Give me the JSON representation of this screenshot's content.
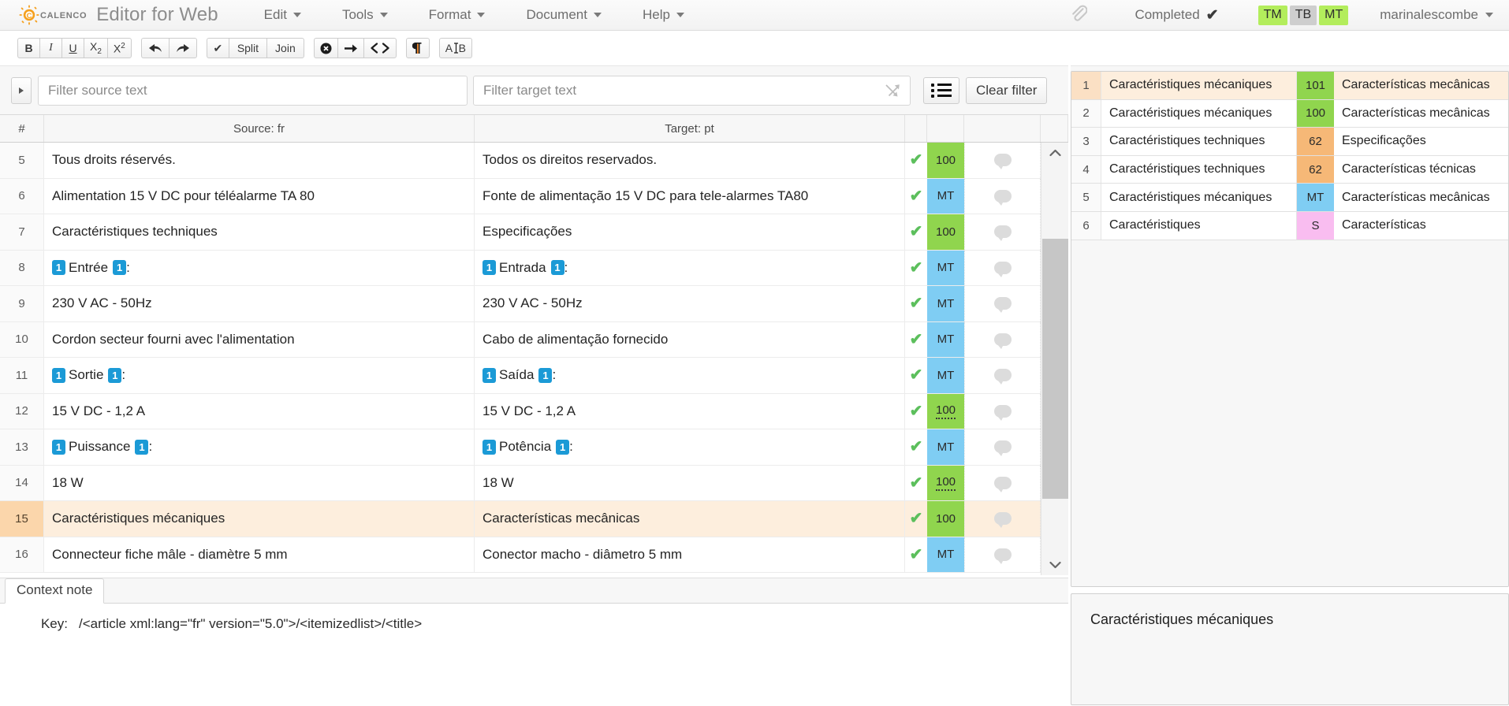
{
  "app": {
    "brand_word": "CALENCO",
    "title": "Editor for Web",
    "accent_orange": "#f5a01e"
  },
  "menubar": {
    "items": [
      {
        "label": "Edit"
      },
      {
        "label": "Tools"
      },
      {
        "label": "Format"
      },
      {
        "label": "Document"
      },
      {
        "label": "Help"
      }
    ],
    "attach_icon": "paperclip-icon",
    "status": {
      "label": "Completed",
      "icon": "check-icon"
    },
    "badges": [
      {
        "label": "TM",
        "color": "#b3ed5c",
        "state": "green"
      },
      {
        "label": "TB",
        "color": "#cecece",
        "state": "grey"
      },
      {
        "label": "MT",
        "color": "#b3ed5c",
        "state": "green"
      }
    ],
    "user": "marinalescombe"
  },
  "toolbar": {
    "groups": [
      [
        {
          "name": "bold",
          "label": "B"
        },
        {
          "name": "italic",
          "label": "I"
        },
        {
          "name": "underline",
          "label": "U"
        },
        {
          "name": "subscript",
          "label": "X2"
        },
        {
          "name": "superscript",
          "label": "X2"
        }
      ],
      [
        {
          "name": "undo",
          "label": "←"
        },
        {
          "name": "redo",
          "label": "→"
        }
      ],
      [
        {
          "name": "validate",
          "label": "✔"
        },
        {
          "name": "split",
          "label": "Split"
        },
        {
          "name": "join",
          "label": "Join"
        }
      ],
      [
        {
          "name": "clear-formatting",
          "label": "✖"
        },
        {
          "name": "insert-tag",
          "label": "➔"
        },
        {
          "name": "show-code",
          "label": "<>"
        }
      ],
      [
        {
          "name": "pilcrow",
          "label": "¶"
        }
      ],
      [
        {
          "name": "compare",
          "label": "A|B"
        }
      ]
    ]
  },
  "filterbar": {
    "expand_button": "▸",
    "source_placeholder": "Filter source text",
    "source_value": "",
    "target_placeholder": "Filter target text",
    "target_value": "",
    "swap_icon": "swap-arrows-icon",
    "list_button": "list-icon",
    "clear_filter_label": "Clear filter"
  },
  "grid": {
    "columns": {
      "num": "#",
      "source": "Source: fr",
      "target": "Target: pt"
    },
    "rows": [
      {
        "num": "5",
        "source_parts": [
          {
            "t": "text",
            "v": "Tous droits réservés."
          }
        ],
        "target_parts": [
          {
            "t": "text",
            "v": "Todos os direitos reservados."
          }
        ],
        "validated": true,
        "score": "100",
        "score_color": "g",
        "score_underline": false,
        "highlight": false
      },
      {
        "num": "6",
        "source_parts": [
          {
            "t": "text",
            "v": "Alimentation 15 V DC pour téléalarme TA 80"
          }
        ],
        "target_parts": [
          {
            "t": "text",
            "v": "Fonte de alimentação 15 V DC para tele-alarmes TA80"
          }
        ],
        "validated": true,
        "score": "MT",
        "score_color": "b",
        "score_underline": false,
        "highlight": false
      },
      {
        "num": "7",
        "source_parts": [
          {
            "t": "text",
            "v": "Caractéristiques techniques"
          }
        ],
        "target_parts": [
          {
            "t": "text",
            "v": "Especificações"
          }
        ],
        "validated": true,
        "score": "100",
        "score_color": "g",
        "score_underline": false,
        "highlight": false
      },
      {
        "num": "8",
        "source_parts": [
          {
            "t": "tag",
            "v": "1"
          },
          {
            "t": "text",
            "v": "Entrée "
          },
          {
            "t": "tag",
            "v": "1"
          },
          {
            "t": "text",
            "v": ":"
          }
        ],
        "target_parts": [
          {
            "t": "tag",
            "v": "1"
          },
          {
            "t": "text",
            "v": "Entrada "
          },
          {
            "t": "tag",
            "v": "1"
          },
          {
            "t": "text",
            "v": ":"
          }
        ],
        "validated": true,
        "score": "MT",
        "score_color": "b",
        "score_underline": false,
        "highlight": false
      },
      {
        "num": "9",
        "source_parts": [
          {
            "t": "text",
            "v": "230 V AC - 50Hz"
          }
        ],
        "target_parts": [
          {
            "t": "text",
            "v": "230 V AC - 50Hz"
          }
        ],
        "validated": true,
        "score": "MT",
        "score_color": "b",
        "score_underline": false,
        "highlight": false
      },
      {
        "num": "10",
        "source_parts": [
          {
            "t": "text",
            "v": "Cordon secteur fourni avec l'alimentation"
          }
        ],
        "target_parts": [
          {
            "t": "text",
            "v": "Cabo de alimentação fornecido"
          }
        ],
        "validated": true,
        "score": "MT",
        "score_color": "b",
        "score_underline": false,
        "highlight": false
      },
      {
        "num": "11",
        "source_parts": [
          {
            "t": "tag",
            "v": "1"
          },
          {
            "t": "text",
            "v": "Sortie "
          },
          {
            "t": "tag",
            "v": "1"
          },
          {
            "t": "text",
            "v": ":"
          }
        ],
        "target_parts": [
          {
            "t": "tag",
            "v": "1"
          },
          {
            "t": "text",
            "v": "Saída "
          },
          {
            "t": "tag",
            "v": "1"
          },
          {
            "t": "text",
            "v": ":"
          }
        ],
        "validated": true,
        "score": "MT",
        "score_color": "b",
        "score_underline": false,
        "highlight": false
      },
      {
        "num": "12",
        "source_parts": [
          {
            "t": "text",
            "v": "15 V DC - 1,2 A"
          }
        ],
        "target_parts": [
          {
            "t": "text",
            "v": "15 V DC - 1,2 A"
          }
        ],
        "validated": true,
        "score": "100",
        "score_color": "g",
        "score_underline": true,
        "highlight": false
      },
      {
        "num": "13",
        "source_parts": [
          {
            "t": "tag",
            "v": "1"
          },
          {
            "t": "text",
            "v": "Puissance "
          },
          {
            "t": "tag",
            "v": "1"
          },
          {
            "t": "text",
            "v": " :"
          }
        ],
        "target_parts": [
          {
            "t": "tag",
            "v": "1"
          },
          {
            "t": "text",
            "v": "Potência "
          },
          {
            "t": "tag",
            "v": "1"
          },
          {
            "t": "text",
            "v": ":"
          }
        ],
        "validated": true,
        "score": "MT",
        "score_color": "b",
        "score_underline": false,
        "highlight": false
      },
      {
        "num": "14",
        "source_parts": [
          {
            "t": "text",
            "v": "18 W"
          }
        ],
        "target_parts": [
          {
            "t": "text",
            "v": "18 W"
          }
        ],
        "validated": true,
        "score": "100",
        "score_color": "g",
        "score_underline": true,
        "highlight": false
      },
      {
        "num": "15",
        "source_parts": [
          {
            "t": "text",
            "v": "Caractéristiques mécaniques"
          }
        ],
        "target_parts": [
          {
            "t": "text",
            "v": "Características mecânicas"
          }
        ],
        "validated": true,
        "score": "100",
        "score_color": "g",
        "score_underline": false,
        "highlight": true
      },
      {
        "num": "16",
        "source_parts": [
          {
            "t": "text",
            "v": "Connecteur fiche mâle - diamètre  5 mm"
          }
        ],
        "target_parts": [
          {
            "t": "text",
            "v": "Conector macho - diâmetro 5 mm"
          }
        ],
        "validated": true,
        "score": "MT",
        "score_color": "b",
        "score_underline": false,
        "highlight": false
      }
    ]
  },
  "context_note": {
    "tab_label": "Context note",
    "key_label": "Key:",
    "key_value": "/<article xml:lang=\"fr\" version=\"5.0\">/<itemizedlist>/<title>"
  },
  "tm_matches": {
    "rows": [
      {
        "num": "1",
        "source": "Caractéristiques mécaniques",
        "score": "101",
        "score_color": "g",
        "target": "Características mecânicas",
        "highlight": true
      },
      {
        "num": "2",
        "source": "Caractéristiques mécaniques",
        "score": "100",
        "score_color": "g",
        "target": "Características mecânicas",
        "highlight": false
      },
      {
        "num": "3",
        "source": "Caractéristiques techniques",
        "score": "62",
        "score_color": "o",
        "target": "Especificações",
        "highlight": false
      },
      {
        "num": "4",
        "source": "Caractéristiques techniques",
        "score": "62",
        "score_color": "o",
        "target": "Características técnicas",
        "highlight": false
      },
      {
        "num": "5",
        "source": "Caractéristiques mécaniques",
        "score": "MT",
        "score_color": "b",
        "target": "Características mecânicas",
        "highlight": false
      },
      {
        "num": "6",
        "source": "Caractéristiques",
        "score": "S",
        "score_color": "p",
        "target": "Características",
        "highlight": false
      }
    ]
  },
  "preview": {
    "text": "Caractéristiques mécaniques"
  }
}
